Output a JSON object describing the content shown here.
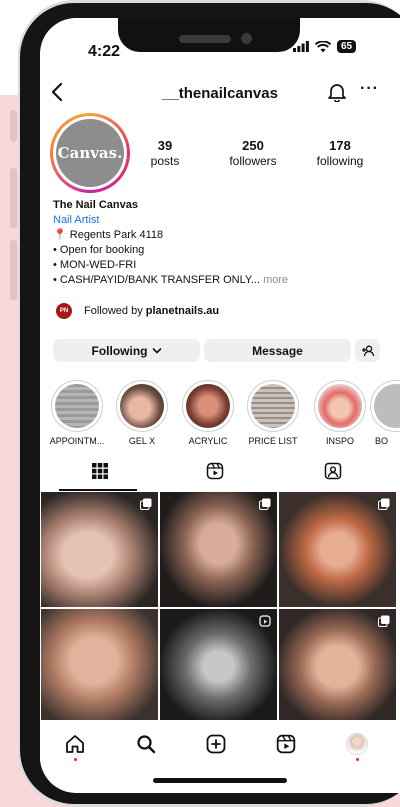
{
  "status_bar": {
    "time": "4:22",
    "battery": "65"
  },
  "header": {
    "username": "__thenailcanvas"
  },
  "profile": {
    "avatar_text": "Canvas.",
    "stats": [
      {
        "value": "39",
        "label": "posts"
      },
      {
        "value": "250",
        "label": "followers"
      },
      {
        "value": "178",
        "label": "following"
      }
    ],
    "name": "The Nail Canvas",
    "category": "Nail Artist",
    "bio_lines": [
      "📍 Regents Park 4118",
      "• Open for booking",
      "• MON-WED-FRI",
      "• CASH/PAYID/BANK TRANSFER ONLY..."
    ],
    "bio_more": "more",
    "followed_prefix": "Followed by",
    "followed_by": "planetnails.au",
    "followed_logo": "PN"
  },
  "actions": {
    "following": "Following",
    "message": "Message"
  },
  "highlights": [
    {
      "label": "APPOINTM..."
    },
    {
      "label": "GEL X"
    },
    {
      "label": "ACRYLIC"
    },
    {
      "label": "PRICE LIST"
    },
    {
      "label": "INSPO"
    },
    {
      "label": "BO"
    }
  ],
  "colors": {
    "link": "#1877f2",
    "story_ring": "#e8305b",
    "accent_dot": "#e0245e"
  },
  "icons": {
    "topbar": [
      "back-arrow-icon",
      "bell-icon",
      "more-icon"
    ],
    "tabs": [
      "grid-icon",
      "reels-icon",
      "tagged-icon"
    ],
    "nav": [
      "home-icon",
      "search-icon",
      "create-icon",
      "reels-icon",
      "profile-icon"
    ]
  }
}
